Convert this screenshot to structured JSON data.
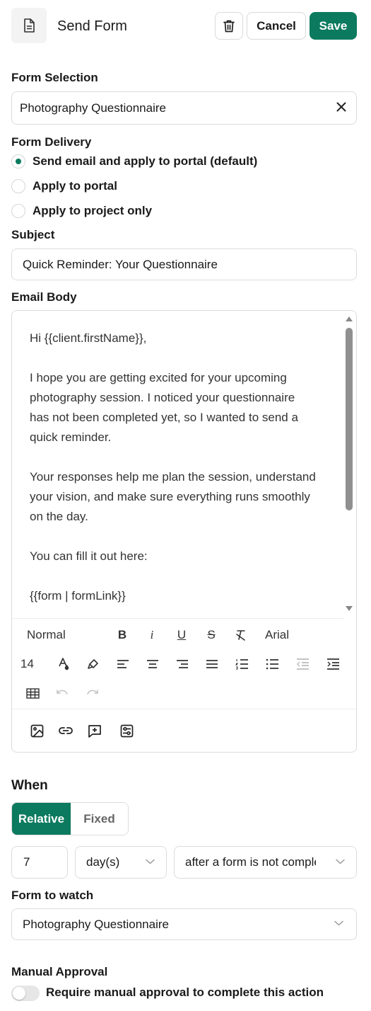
{
  "header": {
    "title": "Send Form",
    "cancel_label": "Cancel",
    "save_label": "Save"
  },
  "form_selection": {
    "label": "Form Selection",
    "value": "Photography Questionnaire"
  },
  "form_delivery": {
    "label": "Form Delivery",
    "options": [
      {
        "label": "Send email and apply to portal (default)",
        "selected": true
      },
      {
        "label": "Apply to portal",
        "selected": false
      },
      {
        "label": "Apply to project only",
        "selected": false
      }
    ]
  },
  "subject": {
    "label": "Subject",
    "value": "Quick Reminder: Your Questionnaire"
  },
  "email_body": {
    "label": "Email Body",
    "lines": [
      "Hi {{client.firstName}},",
      "",
      "I hope you are getting excited for your upcoming",
      "photography session. I noticed your questionnaire",
      "has not been completed yet, so I wanted to send a",
      "quick reminder.",
      "",
      "Your responses help me plan the session, understand",
      "your vision, and make sure everything runs smoothly",
      "on the day.",
      "",
      "You can fill it out here:",
      "",
      "{{form | formLink}}"
    ],
    "toolbar": {
      "paragraph_style": "Normal",
      "bold": "B",
      "italic": "i",
      "underline": "U",
      "strike": "S",
      "font": "Arial",
      "font_size": "14"
    }
  },
  "when": {
    "label": "When",
    "mode_relative": "Relative",
    "mode_fixed": "Fixed",
    "active_mode": "Relative",
    "amount": "7",
    "unit": "day(s)",
    "trigger": "after a form is not completed"
  },
  "form_to_watch": {
    "label": "Form to watch",
    "value": "Photography Questionnaire"
  },
  "manual_approval": {
    "label": "Manual Approval",
    "toggle_label": "Require manual approval to complete this action",
    "enabled": false
  },
  "colors": {
    "accent": "#0b7a5e",
    "border": "#dcdcdc",
    "text": "#1a1a1a"
  }
}
